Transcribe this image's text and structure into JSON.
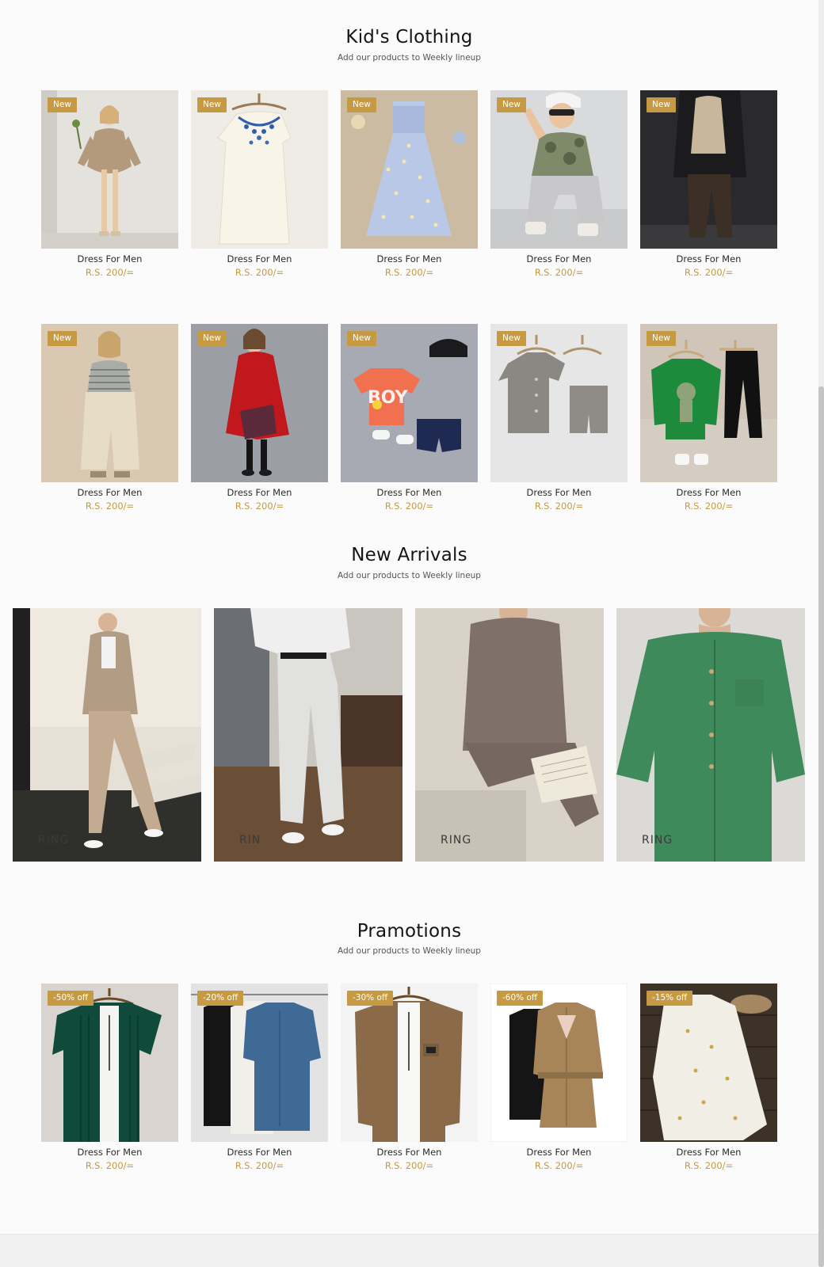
{
  "sections": {
    "kids": {
      "title": "Kid's Clothing",
      "subtitle": "Add our products to Weekly lineup"
    },
    "arrivals": {
      "title": "New Arrivals",
      "subtitle": "Add our products to Weekly lineup"
    },
    "promotions": {
      "title": "Pramotions",
      "subtitle": "Add our products to Weekly lineup"
    }
  },
  "kids_products": [
    {
      "badge": "New",
      "name": "Dress For Men",
      "price": "R.S. 200/="
    },
    {
      "badge": "New",
      "name": "Dress For Men",
      "price": "R.S. 200/="
    },
    {
      "badge": "New",
      "name": "Dress For Men",
      "price": "R.S. 200/="
    },
    {
      "badge": "New",
      "name": "Dress For Men",
      "price": "R.S. 200/="
    },
    {
      "badge": "New",
      "name": "Dress For Men",
      "price": "R.S. 200/="
    },
    {
      "badge": "New",
      "name": "Dress For Men",
      "price": "R.S. 200/="
    },
    {
      "badge": "New",
      "name": "Dress For Men",
      "price": "R.S. 200/="
    },
    {
      "badge": "New",
      "name": "Dress For Men",
      "price": "R.S. 200/="
    },
    {
      "badge": "New",
      "name": "Dress For Men",
      "price": "R.S. 200/="
    },
    {
      "badge": "New",
      "name": "Dress For Men",
      "price": "R.S. 200/="
    }
  ],
  "arrivals": [
    {
      "watermark": "RING"
    },
    {
      "watermark": "RIN"
    },
    {
      "watermark": "RING"
    },
    {
      "watermark": "RING"
    }
  ],
  "promotion_products": [
    {
      "badge": "-50% off",
      "name": "Dress For Men",
      "price": "R.S. 200/="
    },
    {
      "badge": "-20% off",
      "name": "Dress For Men",
      "price": "R.S. 200/="
    },
    {
      "badge": "-30% off",
      "name": "Dress For Men",
      "price": "R.S. 200/="
    },
    {
      "badge": "-60% off",
      "name": "Dress For Men",
      "price": "R.S. 200/="
    },
    {
      "badge": "-15% off",
      "name": "Dress For Men",
      "price": "R.S. 200/="
    }
  ],
  "colors": {
    "accent": "#c59a43",
    "background": "#fbfbfb",
    "text": "#1b1b1b"
  }
}
